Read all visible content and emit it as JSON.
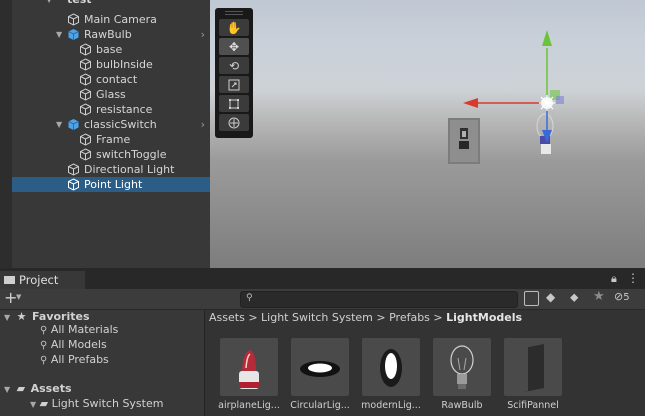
{
  "hierarchy": {
    "root_label": "test",
    "items": [
      {
        "label": "Main Camera"
      },
      {
        "label": "RawBulb"
      },
      {
        "label": "base"
      },
      {
        "label": "bulbInside"
      },
      {
        "label": "contact"
      },
      {
        "label": "Glass"
      },
      {
        "label": "resistance"
      },
      {
        "label": "classicSwitch"
      },
      {
        "label": "Frame"
      },
      {
        "label": "switchToggle"
      },
      {
        "label": "Directional Light"
      },
      {
        "label": "Point Light"
      }
    ],
    "selected": "Point Light"
  },
  "scene": {
    "tools": [
      "hand-tool",
      "move-tool",
      "rotate-tool",
      "scale-tool",
      "rect-tool",
      "transform-tool"
    ],
    "active_tool": "move-tool",
    "gizmo_colors": {
      "x": "#d83a30",
      "y": "#6ac43a",
      "z": "#3a6ad8"
    }
  },
  "project": {
    "tab_label": "Project",
    "add_label": "+",
    "search": {
      "value": "",
      "placeholder": ""
    },
    "hidden_count": "5",
    "favorites": {
      "label": "Favorites",
      "items": [
        "All Materials",
        "All Models",
        "All Prefabs"
      ]
    },
    "assets": {
      "label": "Assets",
      "items": [
        "Light Switch System"
      ]
    },
    "breadcrumb": [
      "Assets",
      "Light Switch System",
      "Prefabs",
      "LightModels"
    ],
    "files": [
      {
        "label": "airplaneLig..."
      },
      {
        "label": "CircularLig..."
      },
      {
        "label": "modernLig..."
      },
      {
        "label": "RawBulb"
      },
      {
        "label": "ScifiPannel"
      }
    ]
  }
}
